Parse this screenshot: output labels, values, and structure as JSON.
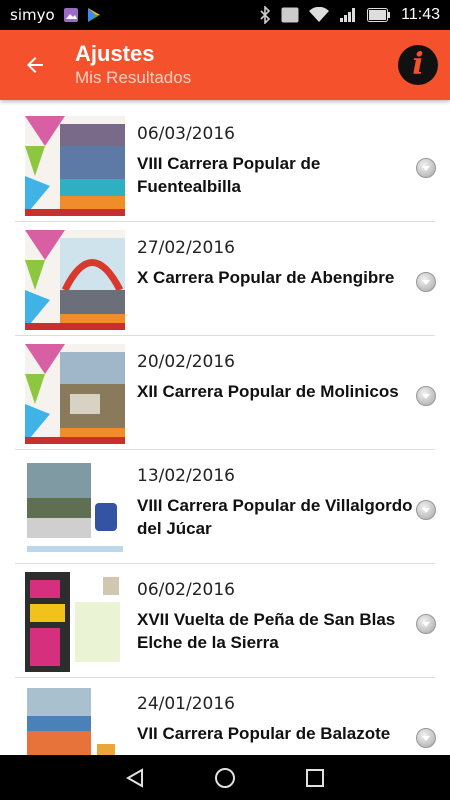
{
  "status_bar": {
    "carrier": "simyo",
    "time": "11:43",
    "nfc": "NFC"
  },
  "app_bar": {
    "title": "Ajustes",
    "subtitle": "Mis Resultados",
    "logo_letter": "i"
  },
  "colors": {
    "accent": "#f4512c",
    "subtitle": "#fbd1c3"
  },
  "results": [
    {
      "date": "06/03/2016",
      "name": "VIII Carrera Popular de Fuentealbilla"
    },
    {
      "date": "27/02/2016",
      "name": "X Carrera Popular de Abengibre"
    },
    {
      "date": "20/02/2016",
      "name": "XII Carrera Popular de Molinicos"
    },
    {
      "date": "13/02/2016",
      "name": "VIII Carrera Popular de Villalgordo del Júcar"
    },
    {
      "date": "06/02/2016",
      "name": "XVII Vuelta de Peña de San Blas Elche de la Sierra"
    },
    {
      "date": "24/01/2016",
      "name": "VII Carrera Popular de Balazote"
    }
  ]
}
